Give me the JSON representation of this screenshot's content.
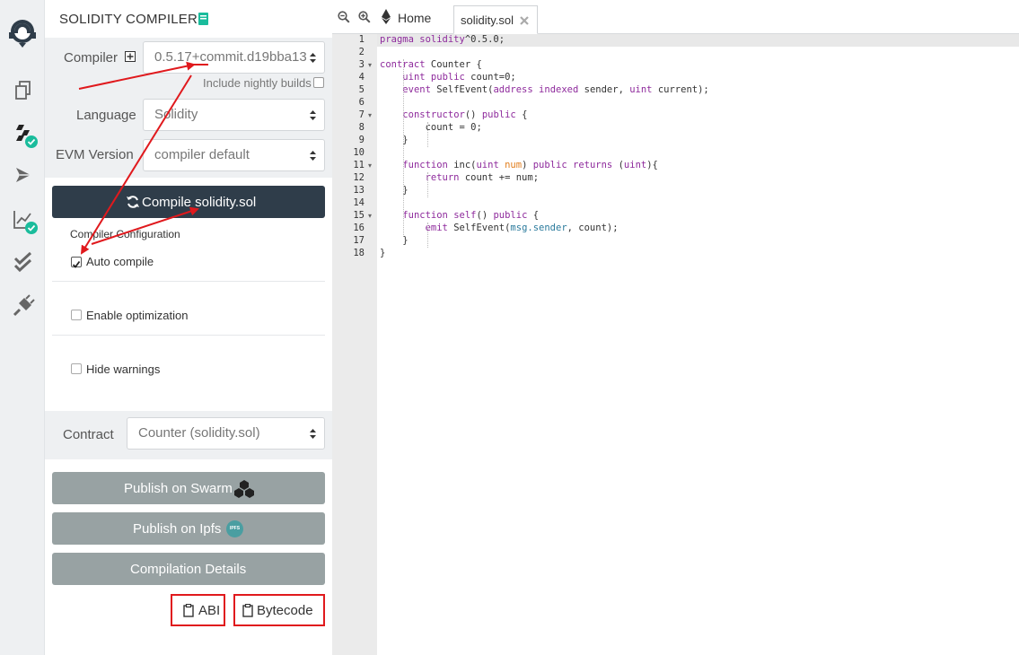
{
  "panel": {
    "title": "SOLIDITY COMPILER",
    "compiler_label": "Compiler",
    "compiler_value": "0.5.17+commit.d19bba13",
    "nightly_label": "Include nightly builds",
    "language_label": "Language",
    "language_value": "Solidity",
    "evm_label": "EVM Version",
    "evm_value": "compiler default",
    "compile_button": "Compile solidity.sol",
    "config_title": "Compiler Configuration",
    "options": [
      {
        "label": "Auto compile",
        "checked": true
      },
      {
        "label": "Enable optimization",
        "checked": false
      },
      {
        "label": "Hide warnings",
        "checked": false
      }
    ],
    "contract_label": "Contract",
    "contract_value": "Counter (solidity.sol)",
    "publish_swarm": "Publish on Swarm",
    "publish_ipfs": "Publish on Ipfs",
    "ipfs_badge": "IPFS",
    "details_button": "Compilation Details",
    "abi_button": "ABI",
    "bytecode_button": "Bytecode"
  },
  "rail": {
    "icons": [
      "remix-logo-icon",
      "file-explorer-icon",
      "solidity-compiler-icon",
      "deploy-run-icon",
      "analysis-icon",
      "testing-icon",
      "plugin-manager-icon"
    ],
    "badge_color": "#1abc9c"
  },
  "editor": {
    "home_tab": "Home",
    "file_tab": "solidity.sol",
    "lines": [
      {
        "n": "1",
        "fold": false
      },
      {
        "n": "2",
        "fold": false
      },
      {
        "n": "3",
        "fold": true
      },
      {
        "n": "4",
        "fold": false
      },
      {
        "n": "5",
        "fold": false
      },
      {
        "n": "6",
        "fold": false
      },
      {
        "n": "7",
        "fold": true
      },
      {
        "n": "8",
        "fold": false
      },
      {
        "n": "9",
        "fold": false
      },
      {
        "n": "10",
        "fold": false
      },
      {
        "n": "11",
        "fold": true
      },
      {
        "n": "12",
        "fold": false
      },
      {
        "n": "13",
        "fold": false
      },
      {
        "n": "14",
        "fold": false
      },
      {
        "n": "15",
        "fold": true
      },
      {
        "n": "16",
        "fold": false
      },
      {
        "n": "17",
        "fold": false
      },
      {
        "n": "18",
        "fold": false
      }
    ],
    "code": [
      [
        [
          "kw",
          "pragma solidity"
        ],
        [
          "",
          "^0.5.0;"
        ]
      ],
      [],
      [
        [
          "kw",
          "contract"
        ],
        [
          "",
          " Counter {"
        ]
      ],
      [
        [
          "",
          "    "
        ],
        [
          "ty",
          "uint"
        ],
        [
          "",
          " "
        ],
        [
          "kw",
          "public"
        ],
        [
          "",
          " count=0;"
        ]
      ],
      [
        [
          "",
          "    "
        ],
        [
          "kw",
          "event"
        ],
        [
          "",
          " SelfEvent("
        ],
        [
          "ty",
          "address"
        ],
        [
          "",
          " "
        ],
        [
          "kw",
          "indexed"
        ],
        [
          "",
          " sender, "
        ],
        [
          "ty",
          "uint"
        ],
        [
          "",
          " current);"
        ]
      ],
      [],
      [
        [
          "",
          "    "
        ],
        [
          "kw",
          "constructor"
        ],
        [
          "",
          "() "
        ],
        [
          "kw",
          "public"
        ],
        [
          "",
          " {"
        ]
      ],
      [
        [
          "",
          "        count = 0;"
        ]
      ],
      [
        [
          "",
          "    }"
        ]
      ],
      [],
      [
        [
          "",
          "    "
        ],
        [
          "kw",
          "function"
        ],
        [
          "",
          " inc("
        ],
        [
          "ty",
          "uint"
        ],
        [
          "",
          " "
        ],
        [
          "nm",
          "num"
        ],
        [
          "",
          ") "
        ],
        [
          "kw",
          "public"
        ],
        [
          "",
          " "
        ],
        [
          "kw",
          "returns"
        ],
        [
          "",
          " ("
        ],
        [
          "ty",
          "uint"
        ],
        [
          "",
          "){"
        ]
      ],
      [
        [
          "",
          "        "
        ],
        [
          "kw",
          "return"
        ],
        [
          "",
          " count += num;"
        ]
      ],
      [
        [
          "",
          "    }"
        ]
      ],
      [],
      [
        [
          "",
          "    "
        ],
        [
          "kw",
          "function"
        ],
        [
          "",
          " "
        ],
        [
          "kw",
          "self"
        ],
        [
          "",
          "() "
        ],
        [
          "kw",
          "public"
        ],
        [
          "",
          " {"
        ]
      ],
      [
        [
          "",
          "        "
        ],
        [
          "kw",
          "emit"
        ],
        [
          "",
          " SelfEvent("
        ],
        [
          "ms",
          "msg.sender"
        ],
        [
          "",
          ", count);"
        ]
      ],
      [
        [
          "",
          "    }"
        ]
      ],
      [
        [
          "",
          "}"
        ]
      ]
    ]
  },
  "colors": {
    "compile_button": "#2f3d4a",
    "gray_button": "#98a2a3",
    "highlight_box": "#e0191d",
    "annotation_arrow": "#e0191d",
    "panel_bg": "#eef0f2"
  }
}
